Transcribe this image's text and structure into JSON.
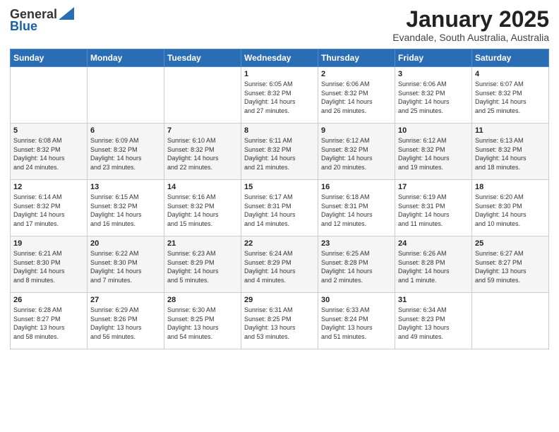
{
  "logo": {
    "general": "General",
    "blue": "Blue"
  },
  "title": "January 2025",
  "subtitle": "Evandale, South Australia, Australia",
  "days_header": [
    "Sunday",
    "Monday",
    "Tuesday",
    "Wednesday",
    "Thursday",
    "Friday",
    "Saturday"
  ],
  "weeks": [
    [
      {
        "day": "",
        "info": ""
      },
      {
        "day": "",
        "info": ""
      },
      {
        "day": "",
        "info": ""
      },
      {
        "day": "1",
        "info": "Sunrise: 6:05 AM\nSunset: 8:32 PM\nDaylight: 14 hours\nand 27 minutes."
      },
      {
        "day": "2",
        "info": "Sunrise: 6:06 AM\nSunset: 8:32 PM\nDaylight: 14 hours\nand 26 minutes."
      },
      {
        "day": "3",
        "info": "Sunrise: 6:06 AM\nSunset: 8:32 PM\nDaylight: 14 hours\nand 25 minutes."
      },
      {
        "day": "4",
        "info": "Sunrise: 6:07 AM\nSunset: 8:32 PM\nDaylight: 14 hours\nand 25 minutes."
      }
    ],
    [
      {
        "day": "5",
        "info": "Sunrise: 6:08 AM\nSunset: 8:32 PM\nDaylight: 14 hours\nand 24 minutes."
      },
      {
        "day": "6",
        "info": "Sunrise: 6:09 AM\nSunset: 8:32 PM\nDaylight: 14 hours\nand 23 minutes."
      },
      {
        "day": "7",
        "info": "Sunrise: 6:10 AM\nSunset: 8:32 PM\nDaylight: 14 hours\nand 22 minutes."
      },
      {
        "day": "8",
        "info": "Sunrise: 6:11 AM\nSunset: 8:32 PM\nDaylight: 14 hours\nand 21 minutes."
      },
      {
        "day": "9",
        "info": "Sunrise: 6:12 AM\nSunset: 8:32 PM\nDaylight: 14 hours\nand 20 minutes."
      },
      {
        "day": "10",
        "info": "Sunrise: 6:12 AM\nSunset: 8:32 PM\nDaylight: 14 hours\nand 19 minutes."
      },
      {
        "day": "11",
        "info": "Sunrise: 6:13 AM\nSunset: 8:32 PM\nDaylight: 14 hours\nand 18 minutes."
      }
    ],
    [
      {
        "day": "12",
        "info": "Sunrise: 6:14 AM\nSunset: 8:32 PM\nDaylight: 14 hours\nand 17 minutes."
      },
      {
        "day": "13",
        "info": "Sunrise: 6:15 AM\nSunset: 8:32 PM\nDaylight: 14 hours\nand 16 minutes."
      },
      {
        "day": "14",
        "info": "Sunrise: 6:16 AM\nSunset: 8:32 PM\nDaylight: 14 hours\nand 15 minutes."
      },
      {
        "day": "15",
        "info": "Sunrise: 6:17 AM\nSunset: 8:31 PM\nDaylight: 14 hours\nand 14 minutes."
      },
      {
        "day": "16",
        "info": "Sunrise: 6:18 AM\nSunset: 8:31 PM\nDaylight: 14 hours\nand 12 minutes."
      },
      {
        "day": "17",
        "info": "Sunrise: 6:19 AM\nSunset: 8:31 PM\nDaylight: 14 hours\nand 11 minutes."
      },
      {
        "day": "18",
        "info": "Sunrise: 6:20 AM\nSunset: 8:30 PM\nDaylight: 14 hours\nand 10 minutes."
      }
    ],
    [
      {
        "day": "19",
        "info": "Sunrise: 6:21 AM\nSunset: 8:30 PM\nDaylight: 14 hours\nand 8 minutes."
      },
      {
        "day": "20",
        "info": "Sunrise: 6:22 AM\nSunset: 8:30 PM\nDaylight: 14 hours\nand 7 minutes."
      },
      {
        "day": "21",
        "info": "Sunrise: 6:23 AM\nSunset: 8:29 PM\nDaylight: 14 hours\nand 5 minutes."
      },
      {
        "day": "22",
        "info": "Sunrise: 6:24 AM\nSunset: 8:29 PM\nDaylight: 14 hours\nand 4 minutes."
      },
      {
        "day": "23",
        "info": "Sunrise: 6:25 AM\nSunset: 8:28 PM\nDaylight: 14 hours\nand 2 minutes."
      },
      {
        "day": "24",
        "info": "Sunrise: 6:26 AM\nSunset: 8:28 PM\nDaylight: 14 hours\nand 1 minute."
      },
      {
        "day": "25",
        "info": "Sunrise: 6:27 AM\nSunset: 8:27 PM\nDaylight: 13 hours\nand 59 minutes."
      }
    ],
    [
      {
        "day": "26",
        "info": "Sunrise: 6:28 AM\nSunset: 8:27 PM\nDaylight: 13 hours\nand 58 minutes."
      },
      {
        "day": "27",
        "info": "Sunrise: 6:29 AM\nSunset: 8:26 PM\nDaylight: 13 hours\nand 56 minutes."
      },
      {
        "day": "28",
        "info": "Sunrise: 6:30 AM\nSunset: 8:25 PM\nDaylight: 13 hours\nand 54 minutes."
      },
      {
        "day": "29",
        "info": "Sunrise: 6:31 AM\nSunset: 8:25 PM\nDaylight: 13 hours\nand 53 minutes."
      },
      {
        "day": "30",
        "info": "Sunrise: 6:33 AM\nSunset: 8:24 PM\nDaylight: 13 hours\nand 51 minutes."
      },
      {
        "day": "31",
        "info": "Sunrise: 6:34 AM\nSunset: 8:23 PM\nDaylight: 13 hours\nand 49 minutes."
      },
      {
        "day": "",
        "info": ""
      }
    ]
  ]
}
